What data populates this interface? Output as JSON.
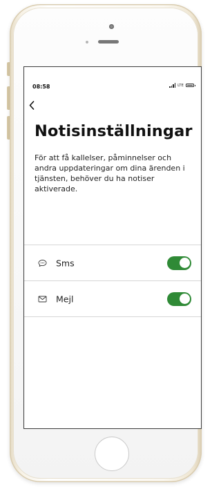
{
  "status_bar": {
    "time": "08:58",
    "network": "LTE"
  },
  "header": {
    "back_icon": "chevron-left-icon",
    "title": "Notisinställningar"
  },
  "intro": {
    "text": "För att få kallelser, påminnelser och andra uppdateringar om dina ärenden i tjänsten, behöver du ha notiser aktiverade."
  },
  "settings": [
    {
      "icon": "chat-bubble-icon",
      "label": "Sms",
      "enabled": true
    },
    {
      "icon": "envelope-icon",
      "label": "Mejl",
      "enabled": true
    }
  ],
  "colors": {
    "toggle_on": "#2f8a36",
    "text": "#111111",
    "divider": "#d6d6d6"
  }
}
